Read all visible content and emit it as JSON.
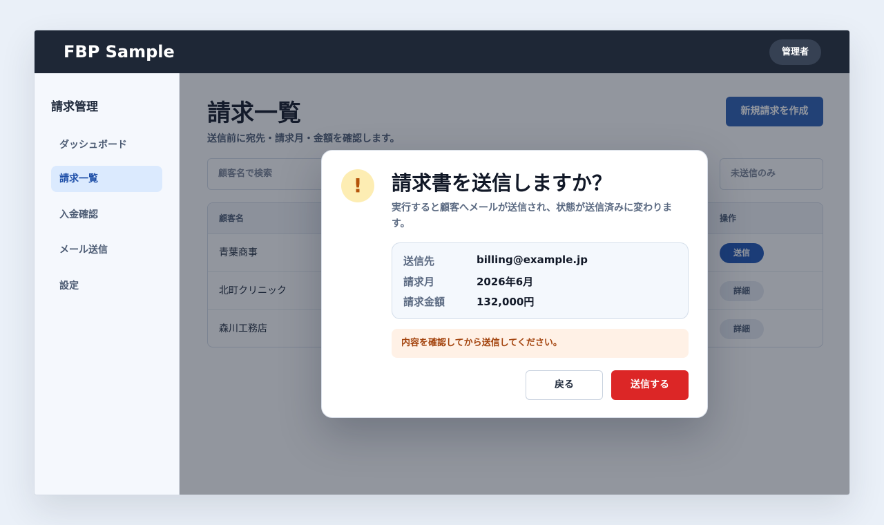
{
  "app": {
    "brand": "FBP Sample",
    "user_label": "管理者"
  },
  "sidebar": {
    "title": "請求管理",
    "items": [
      {
        "label": "ダッシュボード"
      },
      {
        "label": "請求一覧",
        "active": true
      },
      {
        "label": "入金確認"
      },
      {
        "label": "メール送信"
      },
      {
        "label": "設定"
      }
    ]
  },
  "main": {
    "title": "請求一覧",
    "subtitle": "送信前に宛先・請求月・金額を確認します。",
    "new_button": "新規請求を作成",
    "search_placeholder": "顧客名で検索",
    "filter_value": "未送信のみ",
    "table": {
      "headers": {
        "name": "顧客名",
        "action": "操作"
      },
      "rows": [
        {
          "name": "青葉商事",
          "action": "送信"
        },
        {
          "name": "北町クリニック",
          "action": "詳細"
        },
        {
          "name": "森川工務店",
          "action": "詳細"
        }
      ]
    }
  },
  "dialog": {
    "icon": "warning-icon",
    "icon_glyph": "!",
    "title": "請求書を送信しますか？",
    "description": "実行すると顧客へメールが送信され、状態が送信済みに変わります。",
    "details": [
      {
        "label": "送信先",
        "value": "billing@example.jp"
      },
      {
        "label": "請求月",
        "value": "2026年6月"
      },
      {
        "label": "請求金額",
        "value": "132,000円"
      }
    ],
    "warning": "内容を確認してから送信してください。",
    "cancel_label": "戻る",
    "confirm_label": "送信する"
  },
  "colors": {
    "accent": "#2d5fb4",
    "danger": "#dc2626",
    "header_bg": "#1e2736"
  }
}
